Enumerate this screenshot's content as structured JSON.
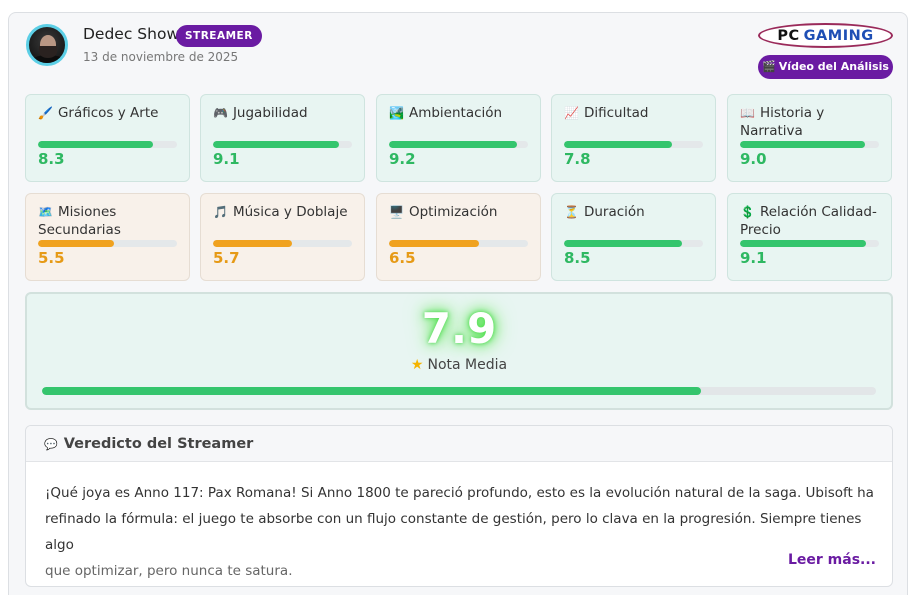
{
  "header": {
    "user_name": "Dedec Show",
    "badge": "STREAMER",
    "date": "13 de noviembre de 2025",
    "logo_pc": "PC",
    "logo_gaming": "GAMING",
    "video_icon": "clapper-icon",
    "video_label": "Vídeo del Análisis",
    "colors": {
      "accent": "#6a1ba2",
      "avatar_ring": "#5ccfe6"
    }
  },
  "ratings": [
    {
      "icon": "🖌️",
      "label": "Gráficos y Arte",
      "score": "8.3",
      "level": 0.83,
      "tone": "good"
    },
    {
      "icon": "🎮",
      "label": "Jugabilidad",
      "score": "9.1",
      "level": 0.91,
      "tone": "good"
    },
    {
      "icon": "🏞️",
      "label": "Ambientación",
      "score": "9.2",
      "level": 0.92,
      "tone": "good"
    },
    {
      "icon": "📈",
      "label": "Dificultad",
      "score": "7.8",
      "level": 0.78,
      "tone": "good"
    },
    {
      "icon": "📖",
      "label": "Historia y Narrativa",
      "score": "9.0",
      "level": 0.9,
      "tone": "good"
    },
    {
      "icon": "🗺️",
      "label": "Misiones Secundarias",
      "score": "5.5",
      "level": 0.55,
      "tone": "mid"
    },
    {
      "icon": "🎵",
      "label": "Música y Doblaje",
      "score": "5.7",
      "level": 0.57,
      "tone": "mid"
    },
    {
      "icon": "🖥️",
      "label": "Optimización",
      "score": "6.5",
      "level": 0.65,
      "tone": "mid"
    },
    {
      "icon": "⏳",
      "label": "Duración",
      "score": "8.5",
      "level": 0.85,
      "tone": "good"
    },
    {
      "icon": "💲",
      "label": "Relación Calidad-Precio",
      "score": "9.1",
      "level": 0.91,
      "tone": "good"
    }
  ],
  "average": {
    "score": "7.9",
    "level": 0.79,
    "icon": "star-icon",
    "label": "Nota Media"
  },
  "verdict": {
    "icon": "speech-bubble-icon",
    "title": "Veredicto del Streamer",
    "line1": "¡Qué joya es Anno 117: Pax Romana! Si Anno 1800 te pareció profundo, esto es la evolución natural de la saga. Ubisoft ha",
    "line2": "refinado la fórmula: el juego te absorbe con un flujo constante de gestión, pero lo clava en la progresión. Siempre tienes algo",
    "line3": "que optimizar, pero nunca te satura.",
    "more": "Leer más..."
  }
}
